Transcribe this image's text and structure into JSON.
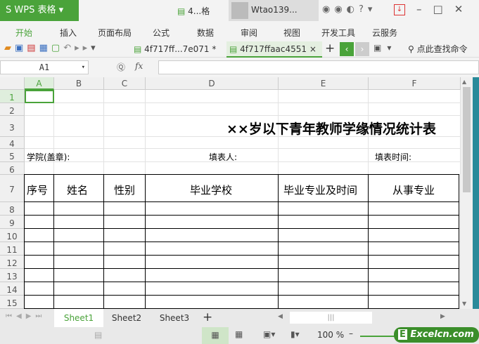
{
  "app": {
    "name": "WPS 表格",
    "doc_short": "4...格",
    "user": "Wtao139..."
  },
  "menu": [
    "开始",
    "插入",
    "页面布局",
    "公式",
    "数据",
    "审阅",
    "视图",
    "开发工具",
    "云服务"
  ],
  "tabs": [
    {
      "label": "4f717ff...7e071 *"
    },
    {
      "label": "4f717ffaac4551"
    }
  ],
  "search": "点此查找命令",
  "namebox": "A1",
  "fx": "fx",
  "columns": [
    "A",
    "B",
    "C",
    "D",
    "E",
    "F"
  ],
  "rows": [
    "1",
    "2",
    "3",
    "4",
    "5",
    "6",
    "7",
    "8",
    "9",
    "10",
    "11",
    "12",
    "13",
    "14",
    "15"
  ],
  "sheet": {
    "title": "××岁以下青年教师学缘情况统计表",
    "college": "学院(盖章):",
    "filler": "填表人:",
    "time": "填表时间:",
    "headers": [
      "序号",
      "姓名",
      "性别",
      "毕业学校",
      "毕业专业及时间",
      "从事专业"
    ]
  },
  "sheets": [
    "Sheet1",
    "Sheet2",
    "Sheet3"
  ],
  "zoom": "100 %",
  "watermark": "Excelcn.com",
  "colors": {
    "accent": "#4aa33a"
  }
}
